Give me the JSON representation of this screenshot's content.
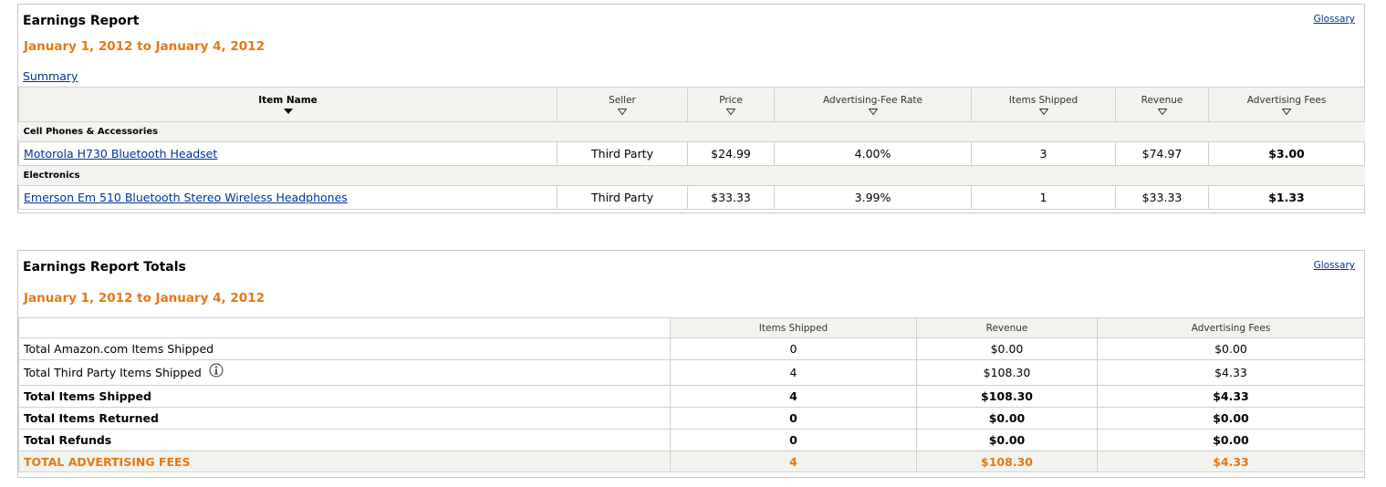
{
  "report": {
    "title": "Earnings Report",
    "glossary_label": "Glossary",
    "date_range": "January 1, 2012 to January 4, 2012",
    "summary_label": "Summary",
    "columns": [
      "Item Name",
      "Seller",
      "Price",
      "Advertising-Fee Rate",
      "Items Shipped",
      "Revenue",
      "Advertising Fees"
    ],
    "groups": [
      {
        "category": "Cell Phones & Accessories",
        "item": {
          "name": "Motorola H730 Bluetooth Headset",
          "seller": "Third Party",
          "price": "$24.99",
          "fee_rate": "4.00%",
          "items_shipped": "3",
          "revenue": "$74.97",
          "advertising_fees": "$3.00"
        }
      },
      {
        "category": "Electronics",
        "item": {
          "name": "Emerson Em 510 Bluetooth Stereo Wireless Headphones",
          "seller": "Third Party",
          "price": "$33.33",
          "fee_rate": "3.99%",
          "items_shipped": "1",
          "revenue": "$33.33",
          "advertising_fees": "$1.33"
        }
      }
    ]
  },
  "totals": {
    "title": "Earnings Report Totals",
    "glossary_label": "Glossary",
    "date_range": "January 1, 2012 to January 4, 2012",
    "columns": [
      "Items Shipped",
      "Revenue",
      "Advertising Fees"
    ],
    "rows": [
      {
        "label": "Total Amazon.com Items Shipped",
        "items_shipped": "0",
        "revenue": "$0.00",
        "advertising_fees": "$0.00"
      },
      {
        "label": "Total Third Party Items Shipped",
        "items_shipped": "4",
        "revenue": "$108.30",
        "advertising_fees": "$4.33"
      },
      {
        "label": "Total Items Shipped",
        "items_shipped": "4",
        "revenue": "$108.30",
        "advertising_fees": "$4.33"
      },
      {
        "label": "Total Items Returned",
        "items_shipped": "0",
        "revenue": "$0.00",
        "advertising_fees": "$0.00"
      },
      {
        "label": "Total Refunds",
        "items_shipped": "0",
        "revenue": "$0.00",
        "advertising_fees": "$0.00"
      },
      {
        "label": "TOTAL ADVERTISING FEES",
        "items_shipped": "4",
        "revenue": "$108.30",
        "advertising_fees": "$4.33"
      }
    ]
  },
  "colors": {
    "accent": "#e47911",
    "link": "#003399",
    "header_bg": "#f2f2ee",
    "border": "#d0d0d0"
  },
  "icons": {
    "sort_active": "sort-desc-filled-icon",
    "sort_inactive": "sort-desc-outline-icon",
    "info": "info-icon"
  }
}
